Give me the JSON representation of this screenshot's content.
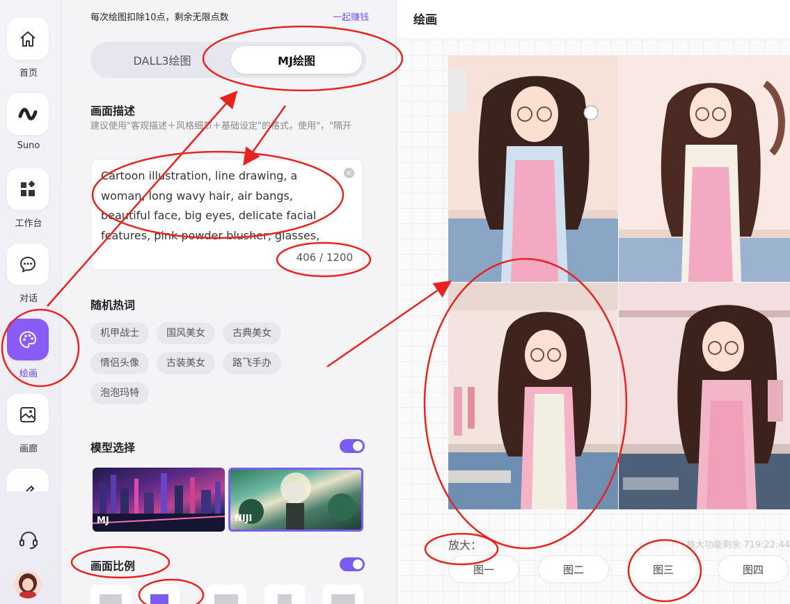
{
  "nav": {
    "items": [
      {
        "label": "首页",
        "icon": "home-icon"
      },
      {
        "label": "Suno",
        "icon": "wave-icon"
      },
      {
        "label": "工作台",
        "icon": "grid-icon"
      },
      {
        "label": "对话",
        "icon": "chat-icon"
      },
      {
        "label": "绘画",
        "icon": "palette-icon",
        "active": true
      },
      {
        "label": "画廊",
        "icon": "gallery-icon"
      }
    ]
  },
  "panel": {
    "points_notice": "每次绘图扣除10点，剩余无限点数",
    "earn_link": "一起赚钱",
    "modes": [
      "DALL3绘图",
      "MJ绘图"
    ],
    "description": {
      "title": "画面描述",
      "hint": "建议使用\"客观描述＋风格细节＋基础设定\"的格式，使用\"，\"隔开",
      "value": "Cartoon illustration, line drawing, a woman, long wavy hair, air bangs, beautiful face, big eyes, delicate facial features, pink powder blusher, glasses, dim and warm tones, pink kitchen",
      "counter": "406 / 1200"
    },
    "hot_words": {
      "title": "随机热词",
      "tags": [
        "机甲战士",
        "国风美女",
        "古典美女",
        "情侣头像",
        "古装美女",
        "路飞手办",
        "泡泡玛特"
      ]
    },
    "model": {
      "title": "模型选择",
      "options": [
        "MJ",
        "NIJI"
      ]
    },
    "ratio": {
      "title": "画面比例"
    }
  },
  "main": {
    "title": "绘画",
    "upscale_label": "放大：",
    "upscale_remaining": "放大功能剩余 719:22:44",
    "upscale_buttons": [
      "图一",
      "图二",
      "图三",
      "图四"
    ]
  },
  "colors": {
    "accent": "#7a5cf0",
    "annotation": "#e8231d"
  }
}
